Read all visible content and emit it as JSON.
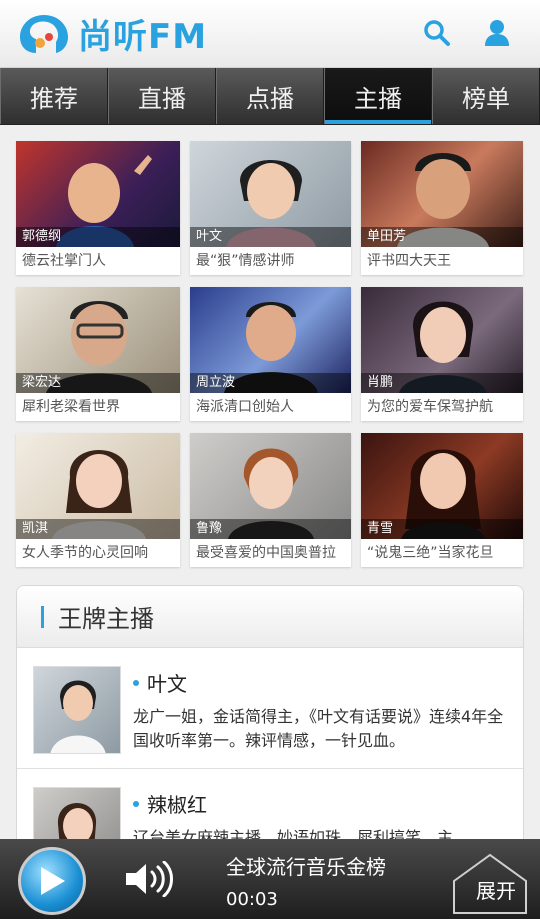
{
  "app": {
    "logo_text": "尚听FM"
  },
  "tabs": [
    {
      "label": "推荐"
    },
    {
      "label": "直播"
    },
    {
      "label": "点播"
    },
    {
      "label": "主播",
      "active": true
    },
    {
      "label": "榜单"
    }
  ],
  "hosts": [
    {
      "name": "郭德纲",
      "desc": "德云社掌门人"
    },
    {
      "name": "叶文",
      "desc": "最“狠”情感讲师"
    },
    {
      "name": "单田芳",
      "desc": "评书四大天王"
    },
    {
      "name": "梁宏达",
      "desc": "犀利老梁看世界"
    },
    {
      "name": "周立波",
      "desc": "海派清口创始人"
    },
    {
      "name": "肖鹏",
      "desc": "为您的爱车保驾护航"
    },
    {
      "name": "凯淇",
      "desc": "女人季节的心灵回响"
    },
    {
      "name": "鲁豫",
      "desc": "最受喜爱的中国奥普拉"
    },
    {
      "name": "青雪",
      "desc": "“说鬼三绝”当家花旦"
    }
  ],
  "ace": {
    "title": "王牌主播",
    "items": [
      {
        "name": "叶文",
        "text": "龙广一姐，金话简得主，《叶文有话要说》连续4年全国收听率第一。辣评情感，一针见血。"
      },
      {
        "name": "辣椒红",
        "text": "辽台美女麻辣主播，妙语如珠，犀利搞笑，主"
      }
    ]
  },
  "player": {
    "title": "全球流行音乐金榜",
    "time": "00:03",
    "expand_label": "展开"
  },
  "colors": {
    "accent": "#2aa2df",
    "tab_bg": "#3a3a3a",
    "player_bg": "#2a2a2a"
  },
  "icons": [
    "search-icon",
    "user-icon",
    "play-icon",
    "volume-icon",
    "expand-icon"
  ]
}
